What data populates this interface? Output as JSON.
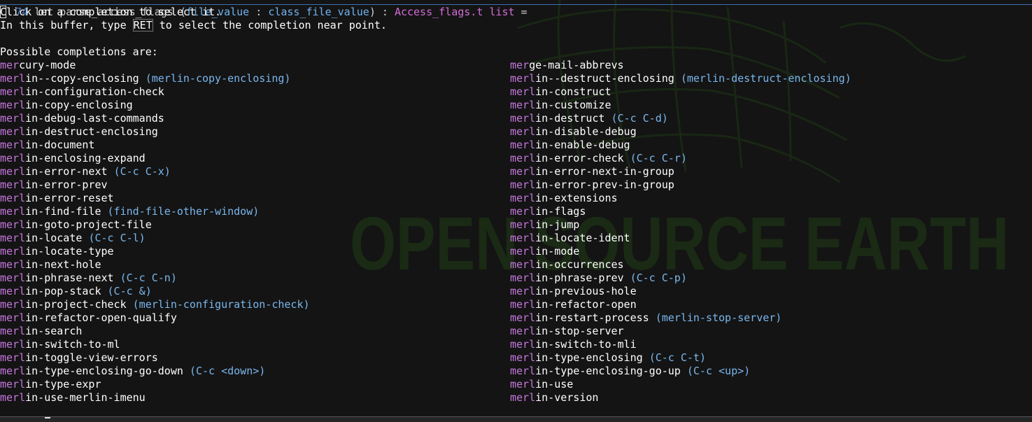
{
  "top_line": {
    "line_number": "74",
    "keyword": "let",
    "fn_name": "parse_access_flags",
    "open_paren": "(",
    "arg1": "file_value",
    "colon1": " : ",
    "arg_type": "class_file_value",
    "close_part": ") : ",
    "ret_type": "Access_flags.t list",
    "equals": " ="
  },
  "help": {
    "line1_first": "C",
    "line1_rest": "lick on a completion to select it.",
    "line2_before": "In this buffer, type ",
    "line2_key": "RET",
    "line2_after": " to select the completion near point.",
    "heading": "Possible completions are:"
  },
  "background_text": "OPEN SOURCE EARTH",
  "colors": {
    "background": "#141414",
    "prefix": "#c678dd",
    "binding": "#7ab7ee",
    "text": "#ffffff",
    "watermark": "#1b2a14"
  },
  "rows": [
    {
      "l_pre": "mer",
      "l_suf": "cury-mode",
      "l_bind": "",
      "r_pre": "mer",
      "r_suf": "ge-mail-abbrevs",
      "r_bind": ""
    },
    {
      "l_pre": "merl",
      "l_suf": "in--copy-enclosing",
      "l_bind": "(merlin-copy-enclosing)",
      "r_pre": "merl",
      "r_suf": "in--destruct-enclosing",
      "r_bind": "(merlin-destruct-enclosing)"
    },
    {
      "l_pre": "merl",
      "l_suf": "in-configuration-check",
      "l_bind": "",
      "r_pre": "merl",
      "r_suf": "in-construct",
      "r_bind": ""
    },
    {
      "l_pre": "merl",
      "l_suf": "in-copy-enclosing",
      "l_bind": "",
      "r_pre": "merl",
      "r_suf": "in-customize",
      "r_bind": ""
    },
    {
      "l_pre": "merl",
      "l_suf": "in-debug-last-commands",
      "l_bind": "",
      "r_pre": "merl",
      "r_suf": "in-destruct",
      "r_bind": "(C-c C-d)"
    },
    {
      "l_pre": "merl",
      "l_suf": "in-destruct-enclosing",
      "l_bind": "",
      "r_pre": "merl",
      "r_suf": "in-disable-debug",
      "r_bind": ""
    },
    {
      "l_pre": "merl",
      "l_suf": "in-document",
      "l_bind": "",
      "r_pre": "merl",
      "r_suf": "in-enable-debug",
      "r_bind": ""
    },
    {
      "l_pre": "merl",
      "l_suf": "in-enclosing-expand",
      "l_bind": "",
      "r_pre": "merl",
      "r_suf": "in-error-check",
      "r_bind": "(C-c C-r)"
    },
    {
      "l_pre": "merl",
      "l_suf": "in-error-next",
      "l_bind": "(C-c C-x)",
      "r_pre": "merl",
      "r_suf": "in-error-next-in-group",
      "r_bind": ""
    },
    {
      "l_pre": "merl",
      "l_suf": "in-error-prev",
      "l_bind": "",
      "r_pre": "merl",
      "r_suf": "in-error-prev-in-group",
      "r_bind": ""
    },
    {
      "l_pre": "merl",
      "l_suf": "in-error-reset",
      "l_bind": "",
      "r_pre": "merl",
      "r_suf": "in-extensions",
      "r_bind": ""
    },
    {
      "l_pre": "merl",
      "l_suf": "in-find-file",
      "l_bind": "(find-file-other-window)",
      "r_pre": "merl",
      "r_suf": "in-flags",
      "r_bind": ""
    },
    {
      "l_pre": "merl",
      "l_suf": "in-goto-project-file",
      "l_bind": "",
      "r_pre": "merl",
      "r_suf": "in-jump",
      "r_bind": ""
    },
    {
      "l_pre": "merl",
      "l_suf": "in-locate",
      "l_bind": "(C-c C-l)",
      "r_pre": "merl",
      "r_suf": "in-locate-ident",
      "r_bind": ""
    },
    {
      "l_pre": "merl",
      "l_suf": "in-locate-type",
      "l_bind": "",
      "r_pre": "merl",
      "r_suf": "in-mode",
      "r_bind": ""
    },
    {
      "l_pre": "merl",
      "l_suf": "in-next-hole",
      "l_bind": "",
      "r_pre": "merl",
      "r_suf": "in-occurrences",
      "r_bind": ""
    },
    {
      "l_pre": "merl",
      "l_suf": "in-phrase-next",
      "l_bind": "(C-c C-n)",
      "r_pre": "merl",
      "r_suf": "in-phrase-prev",
      "r_bind": "(C-c C-p)"
    },
    {
      "l_pre": "merl",
      "l_suf": "in-pop-stack",
      "l_bind": "(C-c &)",
      "r_pre": "merl",
      "r_suf": "in-previous-hole",
      "r_bind": ""
    },
    {
      "l_pre": "merl",
      "l_suf": "in-project-check",
      "l_bind": "(merlin-configuration-check)",
      "r_pre": "merl",
      "r_suf": "in-refactor-open",
      "r_bind": ""
    },
    {
      "l_pre": "merl",
      "l_suf": "in-refactor-open-qualify",
      "l_bind": "",
      "r_pre": "merl",
      "r_suf": "in-restart-process",
      "r_bind": "(merlin-stop-server)"
    },
    {
      "l_pre": "merl",
      "l_suf": "in-search",
      "l_bind": "",
      "r_pre": "merl",
      "r_suf": "in-stop-server",
      "r_bind": ""
    },
    {
      "l_pre": "merl",
      "l_suf": "in-switch-to-ml",
      "l_bind": "",
      "r_pre": "merl",
      "r_suf": "in-switch-to-mli",
      "r_bind": ""
    },
    {
      "l_pre": "merl",
      "l_suf": "in-toggle-view-errors",
      "l_bind": "",
      "r_pre": "merl",
      "r_suf": "in-type-enclosing",
      "r_bind": "(C-c C-t)"
    },
    {
      "l_pre": "merl",
      "l_suf": "in-type-enclosing-go-down",
      "l_bind": "(C-c <down>)",
      "r_pre": "merl",
      "r_suf": "in-type-enclosing-go-up",
      "r_bind": "(C-c <up>)"
    },
    {
      "l_pre": "merl",
      "l_suf": "in-type-expr",
      "l_bind": "",
      "r_pre": "merl",
      "r_suf": "in-use",
      "r_bind": ""
    },
    {
      "l_pre": "merl",
      "l_suf": "in-use-merlin-imenu",
      "l_bind": "",
      "r_pre": "merl",
      "r_suf": "in-version",
      "r_bind": ""
    }
  ]
}
